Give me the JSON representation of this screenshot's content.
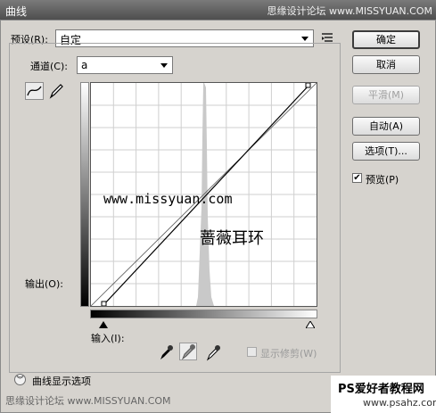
{
  "window": {
    "title": "曲线",
    "watermark_top": "思缘设计论坛 www.MISSYUAN.COM"
  },
  "preset": {
    "label": "预设(R):",
    "value": "自定"
  },
  "channel": {
    "label": "通道(C):",
    "value": "a"
  },
  "buttons": {
    "ok": "确定",
    "cancel": "取消",
    "smooth": "平滑(M)",
    "auto": "自动(A)",
    "options": "选项(T)..."
  },
  "preview": {
    "label": "预览(P)",
    "checked": true
  },
  "labels": {
    "output": "输出(O):",
    "input": "输入(I):",
    "show_clipping": "显示修剪(W)",
    "curve_display_options": "曲线显示选项"
  },
  "overlay_text": {
    "url": "www.missyuan.com",
    "name": "蔷薇耳环"
  },
  "watermark_bottom_left": "思缘设计论坛 www.MISSYUAN.COM",
  "watermark_bottom_right": {
    "line1": "PS爱好者教程网",
    "line2": "www.psahz.com"
  },
  "icons": [
    "curve-tool-icon",
    "pencil-tool-icon",
    "preset-options-icon",
    "black-eyedropper-icon",
    "gray-eyedropper-icon",
    "white-eyedropper-icon",
    "expand-chevron-icon"
  ]
}
